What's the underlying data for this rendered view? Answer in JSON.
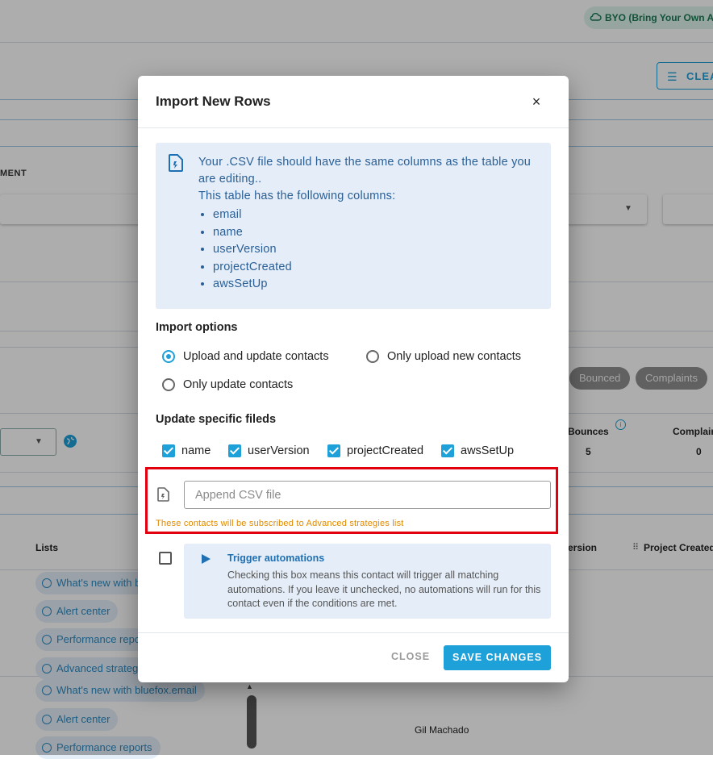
{
  "background": {
    "badge": "BYO (Bring Your Own AV",
    "clear_button": "CLEA",
    "column_label": "MENT",
    "status_chips": [
      "Bounced",
      "Complaints"
    ],
    "stats": [
      {
        "label": "Bounces",
        "value": "5"
      },
      {
        "label": "Complain",
        "value": "0"
      }
    ],
    "table_headers": {
      "lists": "Lists",
      "version": "ersion",
      "project_created": "Project Created"
    },
    "list_chips": [
      "What's new with bl",
      "Alert center",
      "Performance repo",
      "Advanced strategi",
      "What's new with bluefox.email",
      "Alert center",
      "Performance reports"
    ],
    "contact_name": "Gil Machado"
  },
  "modal": {
    "title": "Import New Rows",
    "close_icon": "×",
    "info": {
      "line1": "Your .CSV file should have the same columns as the table you are editing..",
      "line2": "This table has the following columns:",
      "columns": [
        "email",
        "name",
        "userVersion",
        "projectCreated",
        "awsSetUp"
      ]
    },
    "import_options": {
      "title": "Import options",
      "options": [
        {
          "label": "Upload and update contacts",
          "selected": true
        },
        {
          "label": "Only upload new contacts",
          "selected": false
        },
        {
          "label": "Only update contacts",
          "selected": false
        }
      ]
    },
    "update_fields": {
      "title": "Update specific fileds",
      "fields": [
        {
          "label": "name",
          "checked": true
        },
        {
          "label": "userVersion",
          "checked": true
        },
        {
          "label": "projectCreated",
          "checked": true
        },
        {
          "label": "awsSetUp",
          "checked": true
        }
      ]
    },
    "csv": {
      "placeholder": "Append CSV file",
      "hint": "These contacts will be subscribed to Advanced strategies list"
    },
    "trigger": {
      "title": "Trigger automations",
      "description": "Checking this box means this contact will trigger all matching automations. If you leave it unchecked, no automations will run for this contact even if the conditions are met.",
      "checked": false
    },
    "buttons": {
      "close": "CLOSE",
      "save": "SAVE CHANGES"
    }
  },
  "colors": {
    "accent": "#1ea0d9",
    "info_text": "#2a5f96",
    "info_bg": "#e5eef8",
    "hint": "#e08a00",
    "highlight": "#e2000f"
  }
}
